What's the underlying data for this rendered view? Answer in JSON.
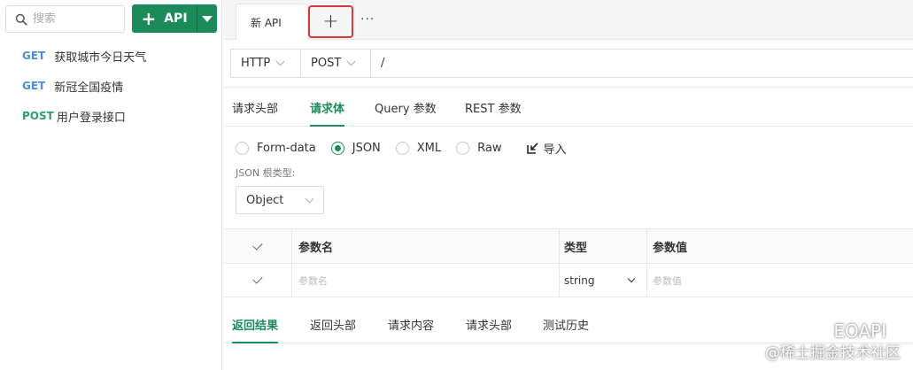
{
  "sidebar": {
    "search_placeholder": "搜索",
    "add_button_label": "API",
    "apis": [
      {
        "method": "GET",
        "name": "获取城市今日天气"
      },
      {
        "method": "GET",
        "name": "新冠全国疫情"
      },
      {
        "method": "POST",
        "name": "用户登录接口"
      }
    ]
  },
  "tabs": {
    "open": [
      {
        "label": "新 API"
      }
    ],
    "add_label": "+",
    "more_label": "···"
  },
  "urlbar": {
    "protocol": "HTTP",
    "method": "POST",
    "path": "/"
  },
  "request_tabs": [
    {
      "label": "请求头部",
      "active": false
    },
    {
      "label": "请求体",
      "active": true
    },
    {
      "label": "Query 参数",
      "active": false
    },
    {
      "label": "REST 参数",
      "active": false
    }
  ],
  "body_types": [
    {
      "label": "Form-data",
      "checked": false
    },
    {
      "label": "JSON",
      "checked": true
    },
    {
      "label": "XML",
      "checked": false
    },
    {
      "label": "Raw",
      "checked": false
    }
  ],
  "import_label": "导入",
  "json_root": {
    "label": "JSON 根类型:",
    "value": "Object"
  },
  "params_table": {
    "headers": [
      "参数名",
      "类型",
      "参数值"
    ],
    "rows": [
      {
        "name_placeholder": "参数名",
        "type": "string",
        "value_placeholder": "参数值"
      }
    ]
  },
  "response_tabs": [
    {
      "label": "返回结果",
      "active": true
    },
    {
      "label": "返回头部",
      "active": false
    },
    {
      "label": "请求内容",
      "active": false
    },
    {
      "label": "请求头部",
      "active": false
    },
    {
      "label": "测试历史",
      "active": false
    }
  ],
  "watermark": {
    "brand": "EOAPI",
    "site": "@稀土掘金技术社区"
  },
  "colors": {
    "accent": "#1c8b5b",
    "get": "#4d8fd6",
    "post": "#2ba070",
    "highlight_border": "#d9363e"
  }
}
